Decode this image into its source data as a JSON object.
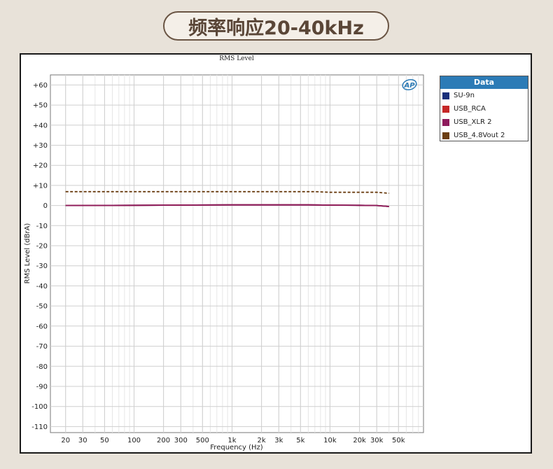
{
  "banner": {
    "title": "频率响应20-40kHz"
  },
  "legend": {
    "header": "Data",
    "items": [
      {
        "label": "SU-9n",
        "color": "#1a2f7a"
      },
      {
        "label": "USB_RCA",
        "color": "#c62828"
      },
      {
        "label": "USB_XLR 2",
        "color": "#8e1b5c"
      },
      {
        "label": "USB_4.8Vout 2",
        "color": "#6b3e12"
      }
    ]
  },
  "logo": "AP",
  "chart_data": {
    "type": "line",
    "title": "RMS Level",
    "xlabel": "Frequency (Hz)",
    "ylabel": "RMS Level (dBrA)",
    "x_scale": "log",
    "xlim": [
      14,
      90000
    ],
    "ylim": [
      -113,
      65
    ],
    "grid": true,
    "legend_position": "right",
    "x_ticks": [
      {
        "value": 20,
        "label": "20"
      },
      {
        "value": 30,
        "label": "30"
      },
      {
        "value": 50,
        "label": "50"
      },
      {
        "value": 100,
        "label": "100"
      },
      {
        "value": 200,
        "label": "200"
      },
      {
        "value": 300,
        "label": "300"
      },
      {
        "value": 500,
        "label": "500"
      },
      {
        "value": 1000,
        "label": "1k"
      },
      {
        "value": 2000,
        "label": "2k"
      },
      {
        "value": 3000,
        "label": "3k"
      },
      {
        "value": 5000,
        "label": "5k"
      },
      {
        "value": 10000,
        "label": "10k"
      },
      {
        "value": 20000,
        "label": "20k"
      },
      {
        "value": 30000,
        "label": "30k"
      },
      {
        "value": 50000,
        "label": "50k"
      }
    ],
    "y_ticks": [
      {
        "value": 60,
        "label": "+60"
      },
      {
        "value": 50,
        "label": "+50"
      },
      {
        "value": 40,
        "label": "+40"
      },
      {
        "value": 30,
        "label": "+30"
      },
      {
        "value": 20,
        "label": "+20"
      },
      {
        "value": 10,
        "label": "+10"
      },
      {
        "value": 0,
        "label": "0"
      },
      {
        "value": -10,
        "label": "-10"
      },
      {
        "value": -20,
        "label": "-20"
      },
      {
        "value": -30,
        "label": "-30"
      },
      {
        "value": -40,
        "label": "-40"
      },
      {
        "value": -50,
        "label": "-50"
      },
      {
        "value": -60,
        "label": "-60"
      },
      {
        "value": -70,
        "label": "-70"
      },
      {
        "value": -80,
        "label": "-80"
      },
      {
        "value": -90,
        "label": "-90"
      },
      {
        "value": -100,
        "label": "-100"
      },
      {
        "value": -110,
        "label": "-110"
      }
    ],
    "series": [
      {
        "name": "SU-9n",
        "color": "#1a2f7a",
        "dash": false,
        "x": [
          20,
          100,
          1000,
          6000,
          10000,
          20000,
          30000,
          40000
        ],
        "y": [
          0,
          0.1,
          0.3,
          0.3,
          0.2,
          0.1,
          0,
          -0.5
        ]
      },
      {
        "name": "USB_RCA",
        "color": "#c62828",
        "dash": false,
        "x": [
          20,
          100,
          1000,
          6000,
          10000,
          20000,
          30000,
          40000
        ],
        "y": [
          0,
          0.1,
          0.3,
          0.3,
          0.2,
          0.1,
          0,
          -0.5
        ]
      },
      {
        "name": "USB_XLR 2",
        "color": "#8e1b5c",
        "dash": false,
        "x": [
          20,
          100,
          1000,
          6000,
          10000,
          20000,
          30000,
          40000
        ],
        "y": [
          0,
          0.1,
          0.3,
          0.3,
          0.2,
          0.1,
          0,
          -0.5
        ]
      },
      {
        "name": "USB_4.8Vout 2",
        "color": "#6b3e12",
        "dash": true,
        "x": [
          20,
          100,
          1000,
          7000,
          10000,
          20000,
          30000,
          40000
        ],
        "y": [
          6.9,
          6.9,
          6.9,
          6.9,
          6.6,
          6.6,
          6.6,
          6.1
        ]
      }
    ]
  }
}
